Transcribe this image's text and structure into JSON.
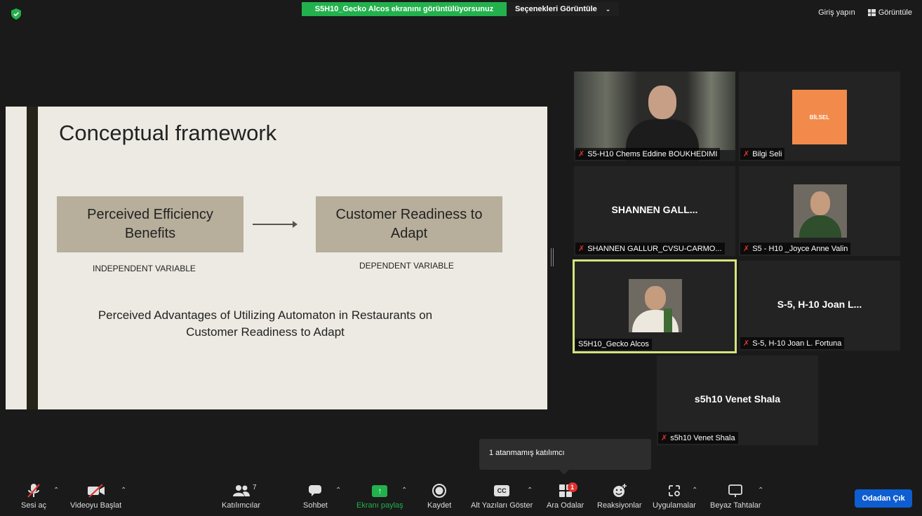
{
  "top_bar": {
    "share_notice": "S5H10_Gecko Alcos ekranını görüntülüyorsunuz",
    "view_options": "Seçenekleri Görüntüle",
    "sign_in": "Giriş yapın",
    "view": "Görüntüle"
  },
  "slide": {
    "title": "Conceptual framework",
    "box_left": "Perceived Efficiency Benefits",
    "box_right": "Customer Readiness to Adapt",
    "label_left": "INDEPENDENT VARIABLE",
    "label_right": "DEPENDENT VARIABLE",
    "description": "Perceived Advantages of Utilizing Automaton in Restaurants on Customer Readiness to Adapt"
  },
  "participants": [
    {
      "label": "S5-H10 Chems Eddine BOUKHEDIMI",
      "muted": true
    },
    {
      "label": "Bilgi Seli",
      "muted": true,
      "logo_text": "BİLSEL"
    },
    {
      "label": "SHANNEN GALLUR_CVSU-CARMO...",
      "center_name": "SHANNEN  GALL...",
      "muted": true
    },
    {
      "label": "S5 - H10 _Joyce Anne Valin",
      "muted": true
    },
    {
      "label": "S5H10_Gecko Alcos",
      "muted": false
    },
    {
      "label": "S-5, H-10 Joan L. Fortuna",
      "center_name": "S-5, H-10 Joan L...",
      "muted": true
    },
    {
      "label": "s5h10 Venet Shala",
      "center_name": "s5h10 Venet Shala",
      "muted": true
    }
  ],
  "tooltip": "1 atanmamış katılımcı",
  "toolbar": {
    "unmute": "Sesi aç",
    "start_video": "Videoyu Başlat",
    "participants": "Katılımcılar",
    "participants_count": "7",
    "chat": "Sohbet",
    "share_screen": "Ekranı paylaş",
    "record": "Kaydet",
    "captions": "Alt Yazıları Göster",
    "captions_icon_text": "CC",
    "breakout": "Ara Odalar",
    "breakout_badge": "1",
    "reactions": "Reaksiyonlar",
    "apps": "Uygulamalar",
    "whiteboards": "Beyaz Tahtalar",
    "leave": "Odadan Çık"
  },
  "colors": {
    "share_green": "#23b14d",
    "leave_blue": "#0e5ed1",
    "active_speaker": "#d6e27e",
    "muted_red": "#e0322e"
  }
}
